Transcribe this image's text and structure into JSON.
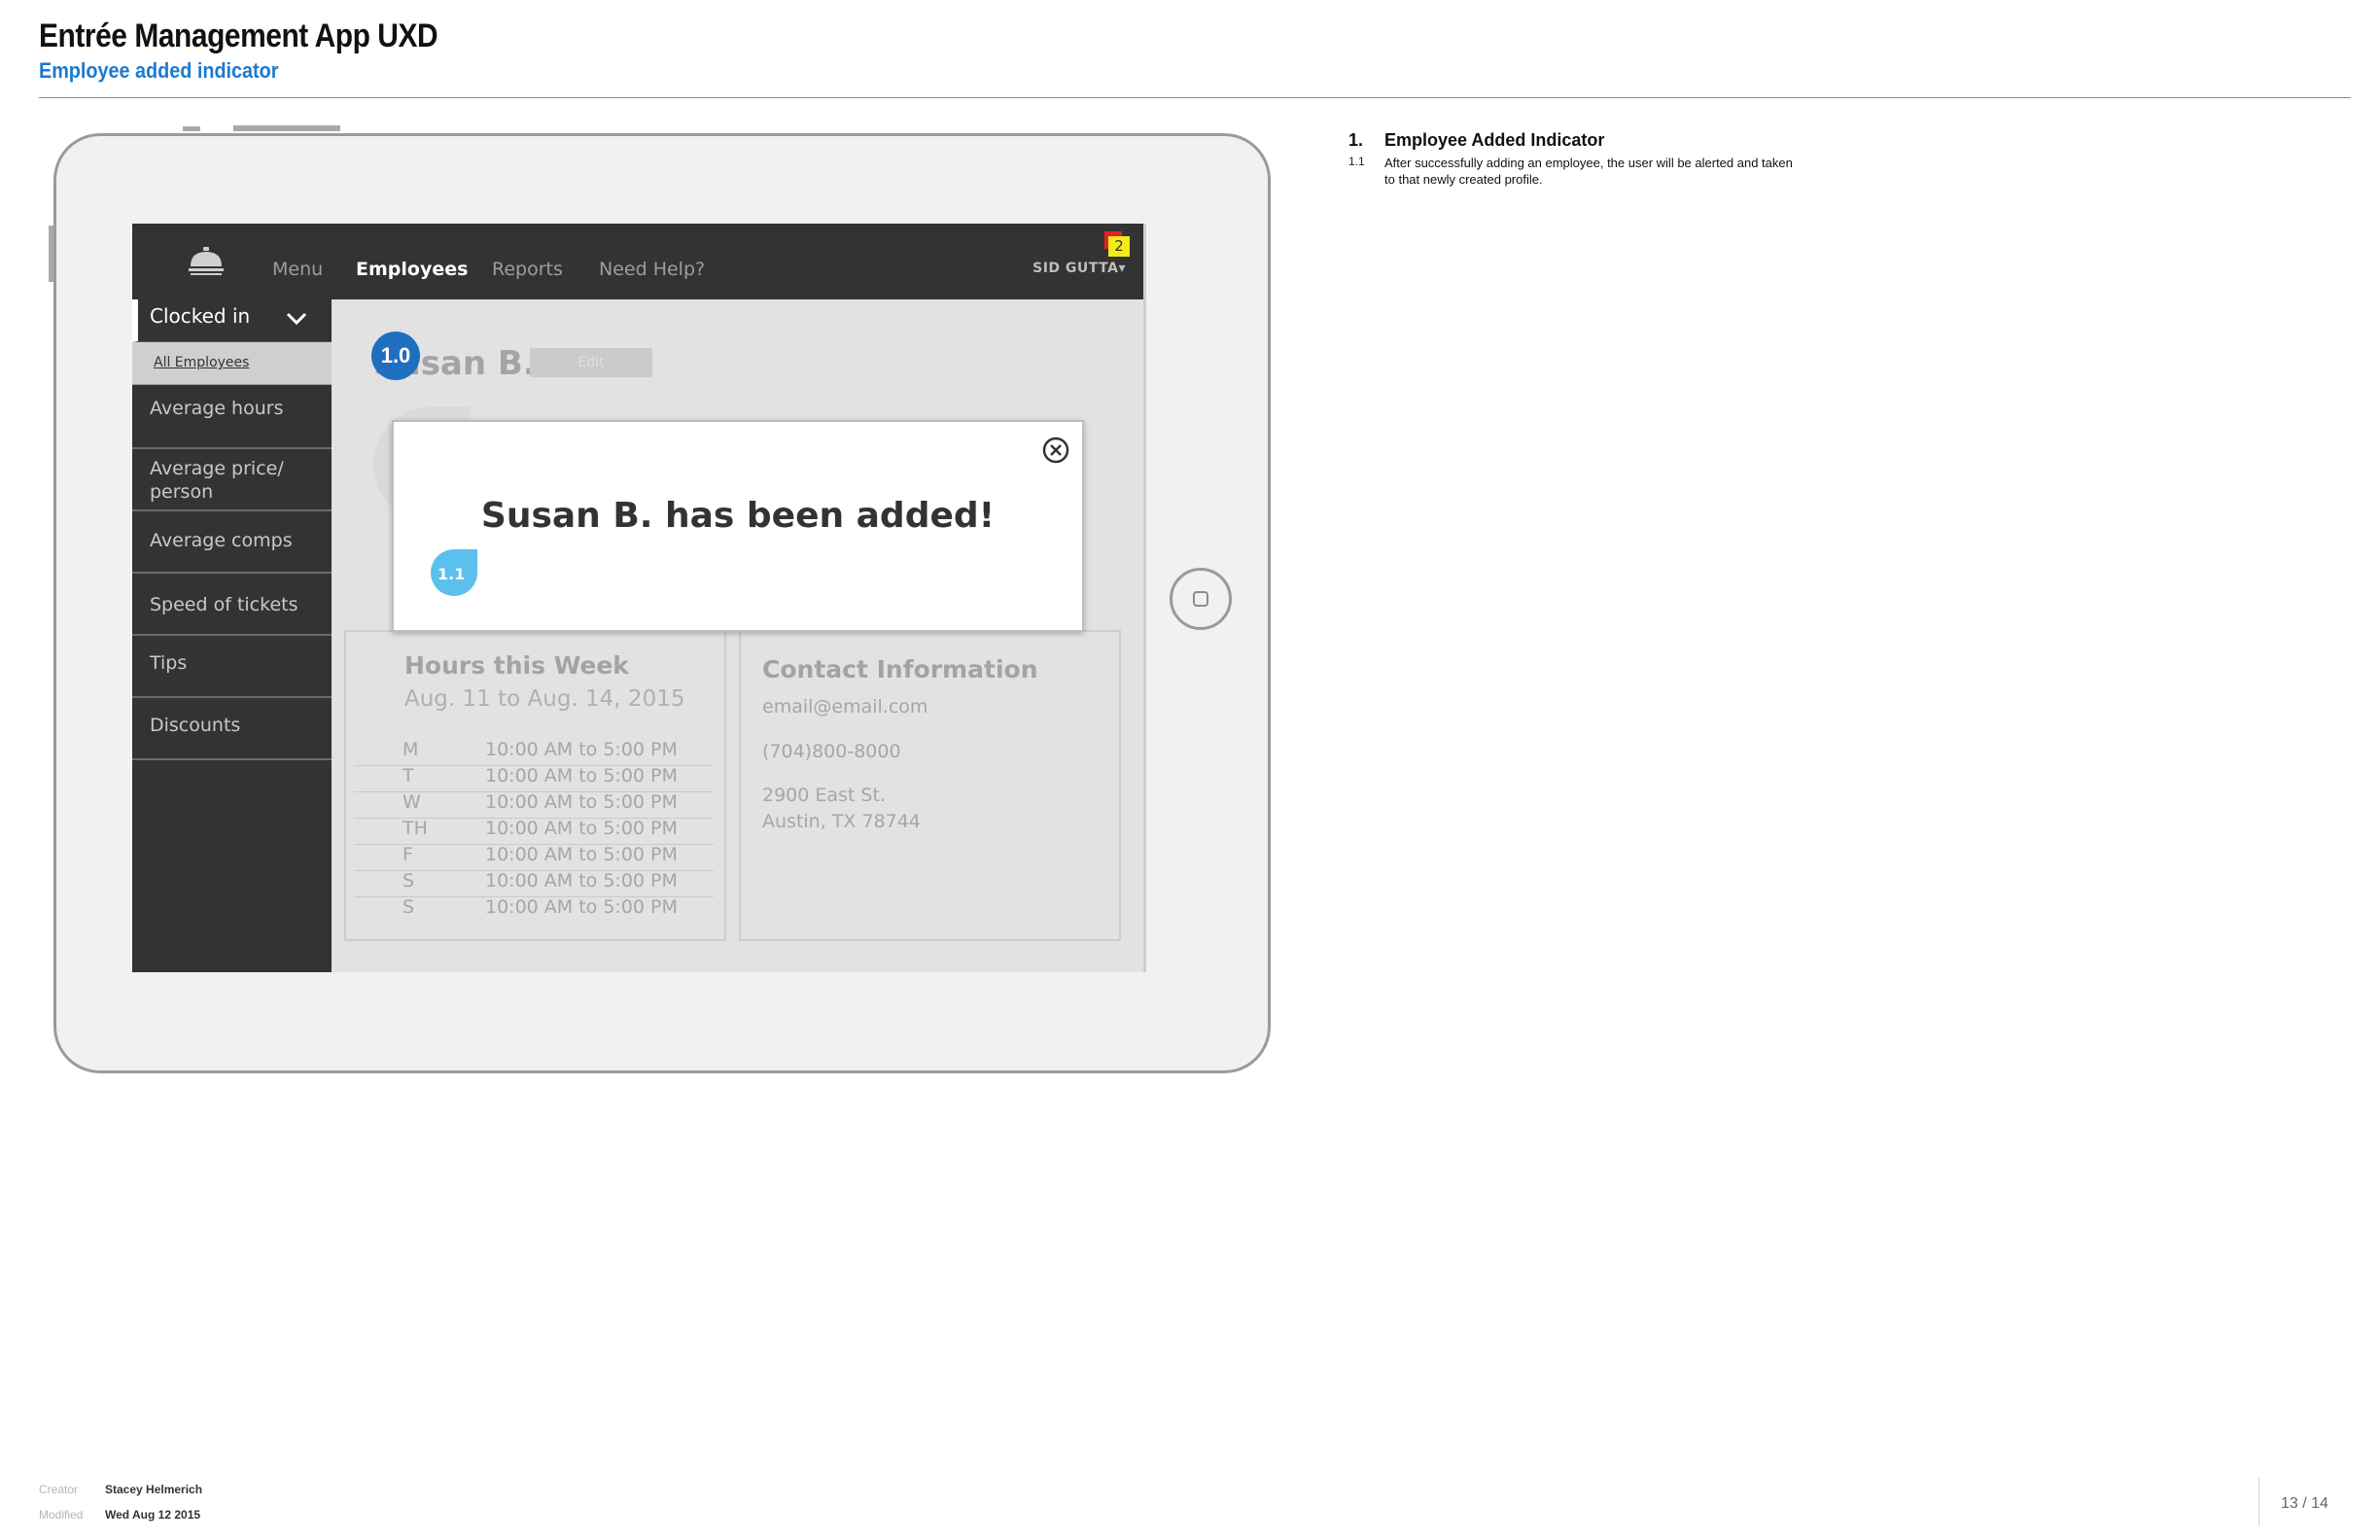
{
  "doc": {
    "title": "Entrée Management App UXD",
    "subtitle": "Employee added indicator"
  },
  "app": {
    "nav": {
      "menu": "Menu",
      "employees": "Employees",
      "reports": "Reports",
      "help": "Need Help?"
    },
    "user": "SID GUTTA",
    "user_caret": "▾",
    "notification_count": "2",
    "sidebar": {
      "clocked_in": "Clocked in",
      "all_employees": "All Employees",
      "items": [
        "Average hours",
        "Average price/\nperson",
        "Average comps",
        "Speed of tickets",
        "Tips",
        "Discounts"
      ]
    },
    "employee": {
      "name": "Susan B.",
      "edit_label": "Edit"
    },
    "hours": {
      "title": "Hours this Week",
      "range": "Aug. 11 to Aug. 14, 2015",
      "rows": [
        {
          "day": "M",
          "time": "10:00 AM to 5:00 PM"
        },
        {
          "day": "T",
          "time": "10:00 AM to 5:00 PM"
        },
        {
          "day": "W",
          "time": "10:00 AM to 5:00 PM"
        },
        {
          "day": "TH",
          "time": "10:00 AM to 5:00 PM"
        },
        {
          "day": "F",
          "time": "10:00 AM to 5:00 PM"
        },
        {
          "day": "S",
          "time": "10:00 AM to 5:00 PM"
        },
        {
          "day": "S",
          "time": "10:00 AM to 5:00 PM"
        }
      ]
    },
    "contact": {
      "title": "Contact Information",
      "email": "email@email.com",
      "phone": "(704)800-8000",
      "address1": "2900 East St.",
      "address2": "Austin, TX 78744"
    },
    "modal": {
      "message": "Susan B. has been added!"
    },
    "callouts": {
      "main": "1.0",
      "modal": "1.1"
    }
  },
  "notes": {
    "number": "1.",
    "heading": "Employee Added Indicator",
    "items": [
      {
        "number": "1.1",
        "text": "After successfully adding an employee, the user will be alerted and taken to that newly created profile."
      }
    ]
  },
  "footer": {
    "creator_label": "Creator",
    "creator": "Stacey Helmerich",
    "modified_label": "Modified",
    "modified": "Wed Aug 12 2015",
    "page": "13 / 14"
  },
  "colors": {
    "accent_blue": "#1a7ad0",
    "callout_blue": "#1f6fc1",
    "callout_light": "#5bc0ee",
    "badge_yellow": "#f2ea1a",
    "badge_red": "#e32222",
    "app_dark": "#333333"
  }
}
